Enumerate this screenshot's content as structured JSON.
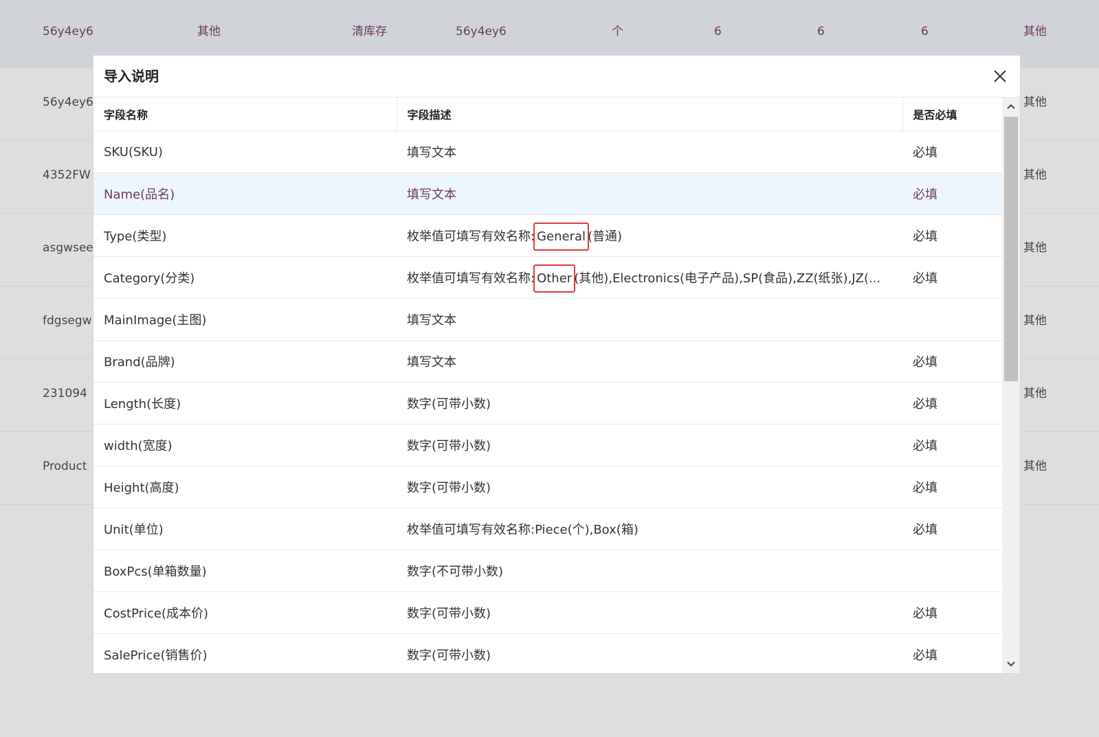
{
  "background_rows": [
    [
      "56y4ey6",
      "其他",
      "清库存",
      "56y4ey6",
      "个",
      "6",
      "6",
      "6",
      "其他"
    ],
    [
      "56y4ey6",
      "",
      "",
      "",
      "",
      "",
      "",
      "",
      "其他"
    ],
    [
      "4352FW",
      "",
      "",
      "",
      "",
      "",
      "",
      "",
      "其他"
    ],
    [
      "asgwsee",
      "",
      "",
      "",
      "",
      "",
      "",
      "",
      "其他"
    ],
    [
      "fdgsegw",
      "",
      "",
      "",
      "",
      "",
      "",
      "",
      "其他"
    ],
    [
      "231094",
      "",
      "",
      "",
      "",
      "",
      "",
      "",
      "其他"
    ],
    [
      "Product",
      "",
      "",
      "",
      "",
      "",
      "",
      "",
      "其他"
    ]
  ],
  "modal": {
    "title": "导入说明",
    "columns": [
      "字段名称",
      "字段描述",
      "是否必填"
    ],
    "rows": [
      {
        "name": "SKU(SKU)",
        "desc": "填写文本",
        "required": "必填"
      },
      {
        "name": "Name(品名)",
        "desc": "填写文本",
        "required": "必填",
        "highlight": true
      },
      {
        "name": "Type(类型)",
        "desc_prefix": "枚举值可填写有效名称:",
        "desc_mark": "General",
        "desc_suffix": "(普通)",
        "required": "必填"
      },
      {
        "name": "Category(分类)",
        "desc_prefix": "枚举值可填写有效名称:",
        "desc_mark": "Other",
        "desc_suffix": "(其他),Electronics(电子产品),SP(食品),ZZ(纸张),JZ(...",
        "required": "必填"
      },
      {
        "name": "MainImage(主图)",
        "desc": "填写文本",
        "required": ""
      },
      {
        "name": "Brand(品牌)",
        "desc": "填写文本",
        "required": "必填"
      },
      {
        "name": "Length(长度)",
        "desc": "数字(可带小数)",
        "required": "必填"
      },
      {
        "name": "width(宽度)",
        "desc": "数字(可带小数)",
        "required": "必填"
      },
      {
        "name": "Height(高度)",
        "desc": "数字(可带小数)",
        "required": "必填"
      },
      {
        "name": "Unit(单位)",
        "desc": "枚举值可填写有效名称:Piece(个),Box(箱)",
        "required": "必填"
      },
      {
        "name": "BoxPcs(单箱数量)",
        "desc": "数字(不可带小数)",
        "required": ""
      },
      {
        "name": "CostPrice(成本价)",
        "desc": "数字(可带小数)",
        "required": "必填"
      },
      {
        "name": "SalePrice(销售价)",
        "desc": "数字(可带小数)",
        "required": "必填"
      }
    ]
  },
  "colors": {
    "highlight_row_bg": "#eef6fd",
    "highlight_text": "#6b3b5e",
    "annotation_box": "#e03a3a"
  },
  "icons": {
    "close": "close-icon",
    "scroll_up": "chevron-up-icon",
    "scroll_down": "chevron-down-icon"
  }
}
